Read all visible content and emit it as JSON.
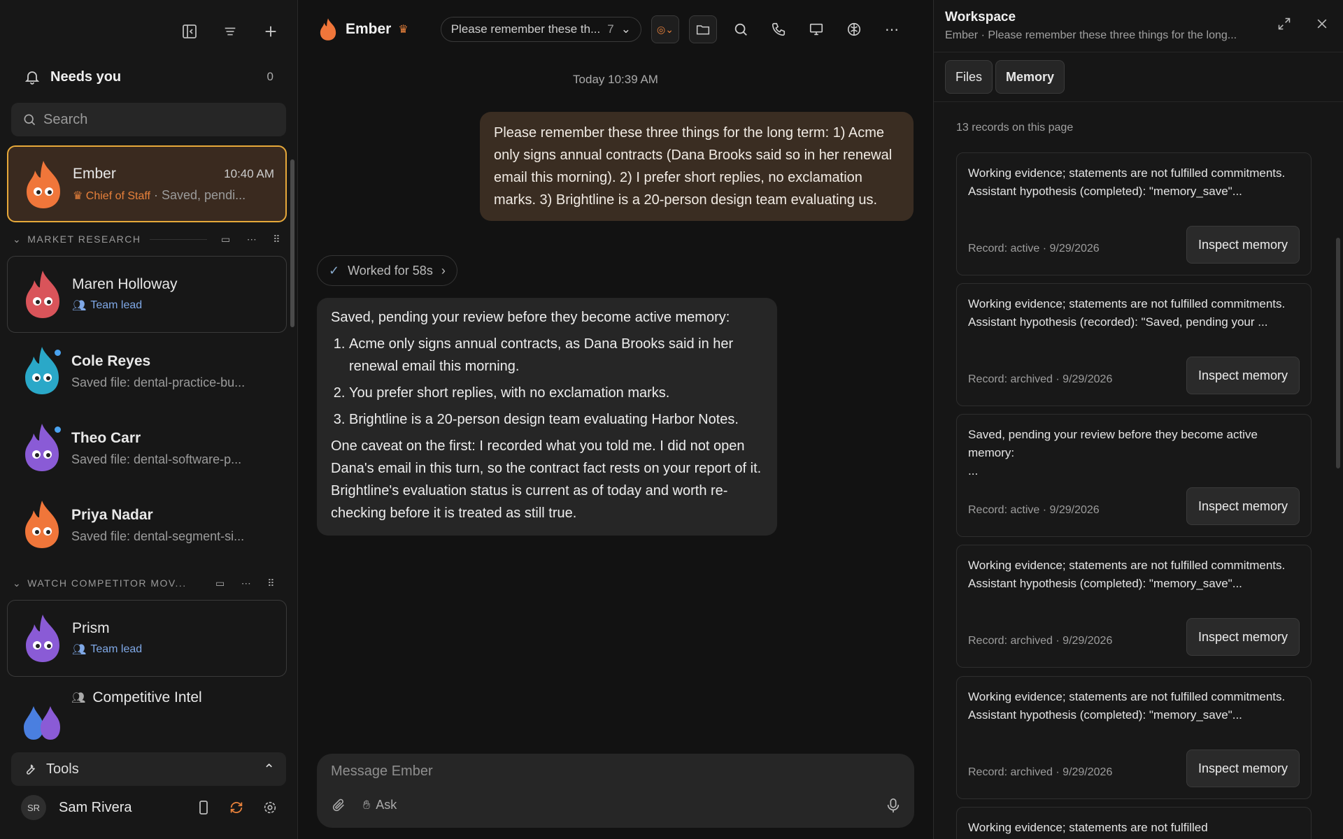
{
  "sidebar": {
    "needs_label": "Needs you",
    "needs_count": "0",
    "search_placeholder": "Search",
    "pinned": {
      "name": "Ember",
      "time": "10:40 AM",
      "role": "Chief of Staff",
      "preview": "Saved, pendi..."
    },
    "sections": [
      {
        "title": "MARKET RESEARCH",
        "lead": {
          "name": "Maren Holloway",
          "role": "Team lead"
        },
        "members": [
          {
            "name": "Cole Reyes",
            "preview": "Saved file: dental-practice-bu..."
          },
          {
            "name": "Theo Carr",
            "preview": "Saved file: dental-software-p..."
          },
          {
            "name": "Priya Nadar",
            "preview": "Saved file: dental-segment-si..."
          }
        ]
      },
      {
        "title": "WATCH COMPETITOR MOV...",
        "lead": {
          "name": "Prism",
          "role": "Team lead"
        },
        "group": {
          "name": "Competitive Intel"
        }
      }
    ],
    "tools_label": "Tools",
    "user": {
      "initials": "SR",
      "name": "Sam Rivera"
    }
  },
  "chat": {
    "title": "Ember",
    "thread_pill": "Please remember these th...",
    "thread_count": "7",
    "timestamp": "Today 10:39 AM",
    "user_message": "Please remember these three things for the long term: 1) Acme only signs annual contracts (Dana Brooks said so in her renewal email this morning). 2) I prefer short replies, no exclamation marks. 3) Brightline is a 20-person design team evaluating us.",
    "worked": "Worked for 58s",
    "reply": {
      "intro": "Saved, pending your review before they become active memory:",
      "items": [
        "Acme only signs annual contracts, as Dana Brooks said in her renewal email this morning.",
        "You prefer short replies, with no exclamation marks.",
        "Brightline is a 20-person design team evaluating Harbor Notes."
      ],
      "outro": "One caveat on the first: I recorded what you told me. I did not open Dana's email in this turn, so the contract fact rests on your report of it. Brightline's evaluation status is current as of today and worth re-checking before it is treated as still true."
    },
    "composer_placeholder": "Message Ember",
    "ask_label": "Ask"
  },
  "workspace": {
    "title": "Workspace",
    "subtitle": "Ember · Please remember these three things for the long...",
    "tabs": [
      "Files",
      "Memory"
    ],
    "record_count": "13 records on this page",
    "inspect_label": "Inspect memory",
    "records": [
      {
        "text": "Working evidence; statements are not fulfilled commitments.\nAssistant hypothesis (completed): \"memory_save\"...",
        "meta": "Record: active · 9/29/2026"
      },
      {
        "text": "Working evidence; statements are not fulfilled commitments.\nAssistant hypothesis (recorded): \"Saved, pending your ...",
        "meta": "Record: archived · 9/29/2026"
      },
      {
        "text": "Saved, pending your review before they become active memory:\n...",
        "meta": "Record: active · 9/29/2026"
      },
      {
        "text": "Working evidence; statements are not fulfilled commitments.\nAssistant hypothesis (completed): \"memory_save\"...",
        "meta": "Record: archived · 9/29/2026"
      },
      {
        "text": "Working evidence; statements are not fulfilled commitments.\nAssistant hypothesis (completed): \"memory_save\"...",
        "meta": "Record: archived · 9/29/2026"
      },
      {
        "text": "Working evidence; statements are not fulfilled",
        "meta": ""
      }
    ]
  },
  "colors": {
    "accent": "#e8813b",
    "selected_border": "#e7a93a",
    "team_lead": "#7fa8e6"
  }
}
